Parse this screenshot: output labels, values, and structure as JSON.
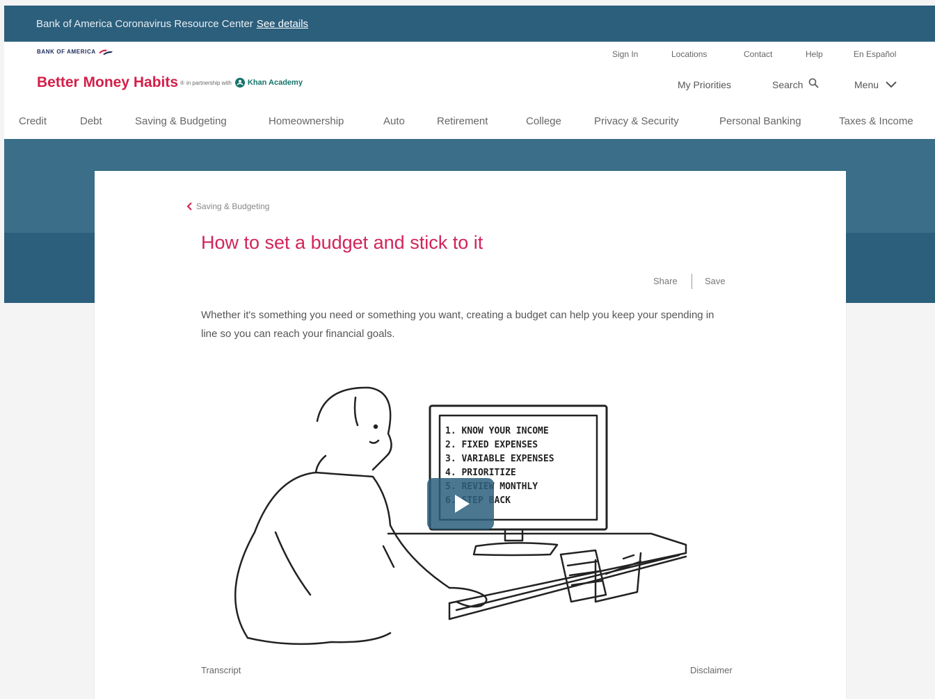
{
  "banner": {
    "text": "Bank of America Coronavirus Resource Center",
    "link": "See details"
  },
  "header": {
    "boa_logo_text": "BANK OF AMERICA",
    "utility_links": [
      "Sign In",
      "Locations",
      "Contact",
      "Help",
      "En Español"
    ],
    "brand": "Better Money Habits",
    "brand_mark": "®",
    "partnership": "in partnership with",
    "partner": "Khan Academy",
    "my_priorities": "My Priorities",
    "search": "Search",
    "menu": "Menu",
    "nav": [
      "Credit",
      "Debt",
      "Saving & Budgeting",
      "Homeownership",
      "Auto",
      "Retirement",
      "College",
      "Privacy & Security",
      "Personal Banking",
      "Taxes & Income"
    ]
  },
  "article": {
    "breadcrumb": "Saving & Budgeting",
    "title": "How to set a budget and stick to it",
    "share": "Share",
    "save": "Save",
    "intro": "Whether it's something you need or something you want, creating a budget can help you keep your spending in line so you can reach your financial goals.",
    "video": {
      "screen_lines": [
        "1. KNOW YOUR INCOME",
        "2. FIXED EXPENSES",
        "3. VARIABLE EXPENSES",
        "4. PRIORITIZE",
        "5. REVIEW MONTHLY",
        "6. STEP BACK"
      ]
    },
    "transcript": "Transcript",
    "disclaimer": "Disclaimer"
  },
  "colors": {
    "banner": "#2c5f7c",
    "brand": "#d21f4a",
    "title": "#d1245a",
    "partner": "#14746a"
  }
}
